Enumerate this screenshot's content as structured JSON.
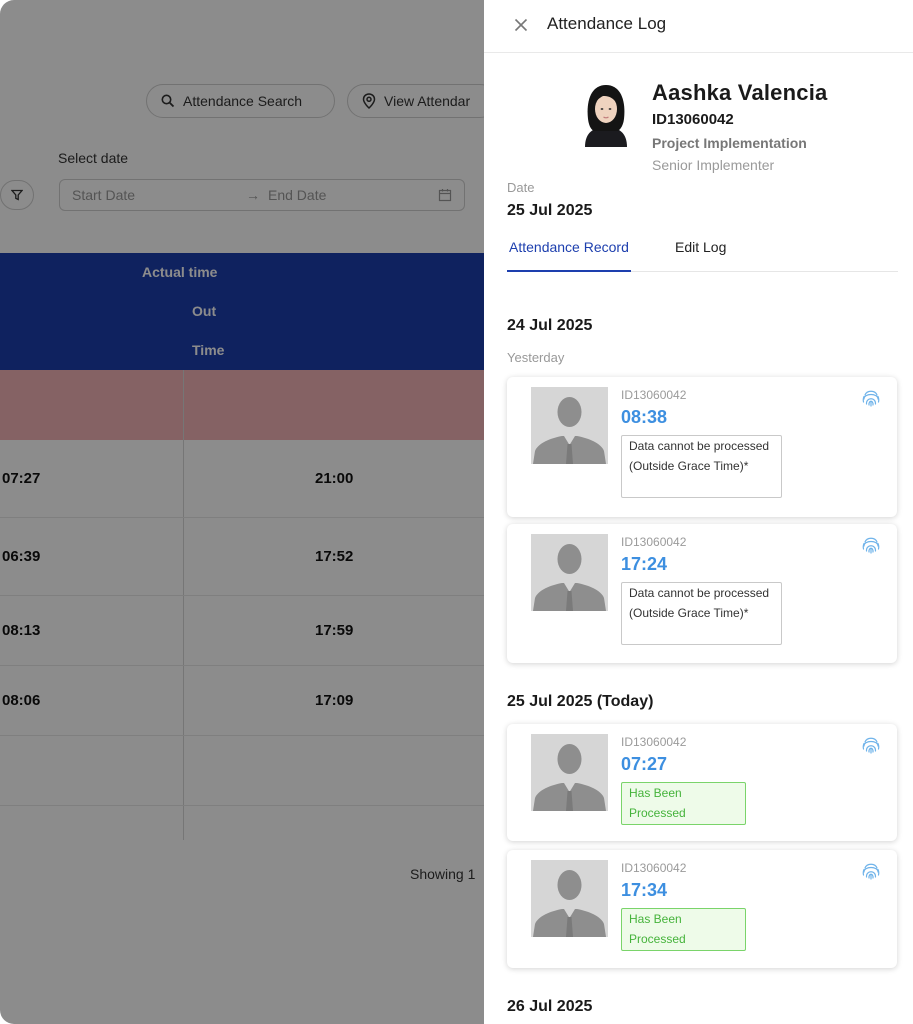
{
  "background": {
    "search_button": "Attendance Search",
    "view_button": "View Attendar",
    "select_date_label": "Select date",
    "start_date_placeholder": "Start Date",
    "end_date_placeholder": "End Date",
    "range_arrow": "→",
    "table_headers": [
      "Actual time",
      "Out",
      "Time"
    ],
    "rows": [
      {
        "in": "07:27",
        "out": "21:00"
      },
      {
        "in": "06:39",
        "out": "17:52"
      },
      {
        "in": "08:13",
        "out": "17:59"
      },
      {
        "in": "08:06",
        "out": "17:09"
      }
    ],
    "showing_text": "Showing 1"
  },
  "drawer": {
    "title": "Attendance Log",
    "employee": {
      "name": "Aashka Valencia",
      "id": "ID13060042",
      "department": "Project Implementation",
      "position": "Senior Implementer"
    },
    "date_label": "Date",
    "date_value": "25 Jul 2025",
    "tabs": [
      {
        "label": "Attendance Record",
        "active": true
      },
      {
        "label": "Edit Log",
        "active": false
      }
    ],
    "days": [
      {
        "heading": "24 Jul 2025",
        "subheading": "Yesterday"
      },
      {
        "heading": "25 Jul 2025 (Today)"
      },
      {
        "heading": "26 Jul 2025"
      }
    ],
    "records": [
      {
        "id": "ID13060042",
        "time": "08:38",
        "status": "Data cannot be processed (Outside Grace Time)*",
        "status_type": "error",
        "icon": "fingerprint-icon"
      },
      {
        "id": "ID13060042",
        "time": "17:24",
        "status": "Data cannot be processed (Outside Grace Time)*",
        "status_type": "error",
        "icon": "fingerprint-icon"
      },
      {
        "id": "ID13060042",
        "time": "07:27",
        "status": "Has Been Processed",
        "status_type": "success",
        "icon": "fingerprint-icon"
      },
      {
        "id": "ID13060042",
        "time": "17:34",
        "status": "Has Been Processed",
        "status_type": "success",
        "icon": "fingerprint-icon"
      }
    ]
  },
  "colors": {
    "primary": "#1d3fae",
    "time_blue": "#3d8fe0",
    "success_green": "#45b33b",
    "row_pink": "#f3b3b6"
  }
}
